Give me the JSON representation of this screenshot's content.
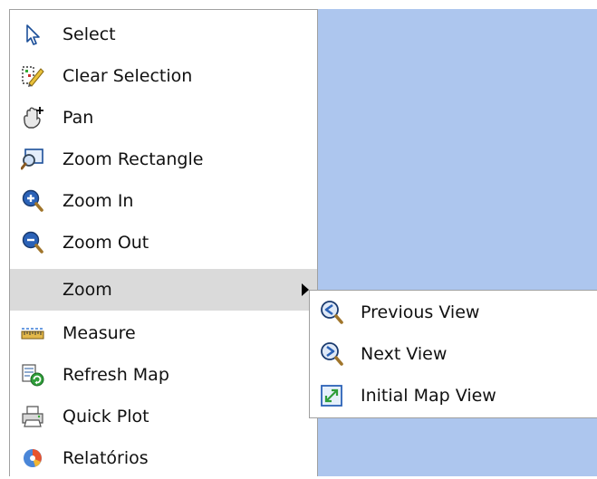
{
  "menu": {
    "items": [
      {
        "label": "Select",
        "icon": "cursor-arrow-icon"
      },
      {
        "label": "Clear Selection",
        "icon": "clear-selection-icon"
      },
      {
        "label": "Pan",
        "icon": "pan-hand-icon"
      },
      {
        "label": "Zoom Rectangle",
        "icon": "zoom-rectangle-icon"
      },
      {
        "label": "Zoom In",
        "icon": "zoom-in-icon"
      },
      {
        "label": "Zoom Out",
        "icon": "zoom-out-icon"
      },
      {
        "label": "Zoom",
        "icon": "",
        "submenu": true
      },
      {
        "label": "Measure",
        "icon": "ruler-icon"
      },
      {
        "label": "Refresh Map",
        "icon": "refresh-map-icon"
      },
      {
        "label": "Quick Plot",
        "icon": "printer-icon"
      },
      {
        "label": "Relatórios",
        "icon": "reports-icon"
      }
    ]
  },
  "submenu": {
    "items": [
      {
        "label": "Previous View",
        "icon": "previous-view-icon"
      },
      {
        "label": "Next View",
        "icon": "next-view-icon"
      },
      {
        "label": "Initial Map View",
        "icon": "initial-map-view-icon"
      }
    ]
  },
  "colors": {
    "map_background": "#adc6ee",
    "highlight": "#dadada",
    "border": "#a0a0a0"
  }
}
